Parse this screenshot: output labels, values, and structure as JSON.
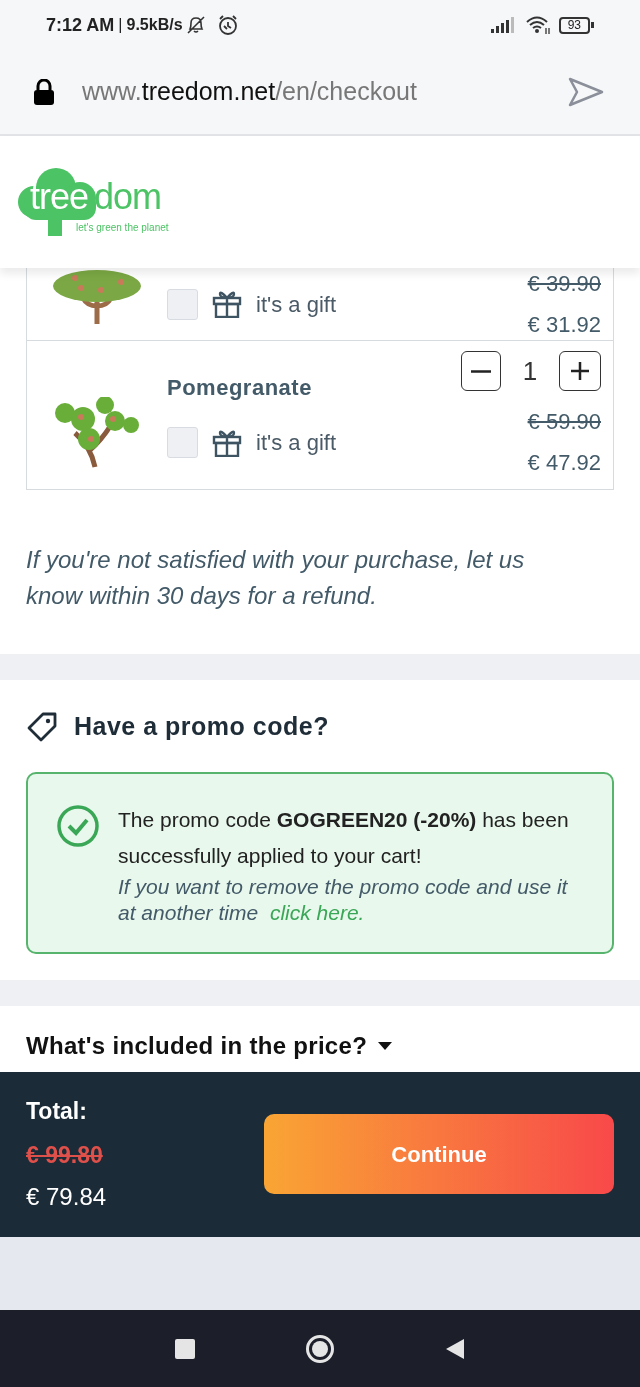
{
  "status_bar": {
    "time": "7:12 AM",
    "separator": "|",
    "speed": "9.5kB/s",
    "battery": "93"
  },
  "browser": {
    "url_prefix": "www.",
    "url_domain": "treedom.net",
    "url_path": "/en/checkout"
  },
  "logo": {
    "name_on_cloud": "tree",
    "name_rest": "dom",
    "tagline": "let's green the planet"
  },
  "cart_items": [
    {
      "kind": "cropped",
      "gift_label": "it's a gift",
      "gift_checked": false,
      "old_price": "€ 39.90",
      "price": "€ 31.92"
    },
    {
      "kind": "full",
      "name": "Pomegranate",
      "quantity": "1",
      "gift_label": "it's a gift",
      "gift_checked": false,
      "old_price": "€ 59.90",
      "price": "€ 47.92"
    }
  ],
  "refund_note": "If you're not satisfied with your purchase, let us know within 30 days for a refund.",
  "promo": {
    "heading": "Have a promo code?",
    "message": "The promo code **GOGREEN20 (-20%)** has been successfully applied to your cart!",
    "remove_note": "If you want to remove the promo code and use it at another time",
    "link": "click here."
  },
  "price_details": {
    "label": "What's included in the price?",
    "expanded": false
  },
  "footer": {
    "total_label": "Total:",
    "old_total": "€ 99.80",
    "total": "€ 79.84",
    "button": "Continue"
  }
}
